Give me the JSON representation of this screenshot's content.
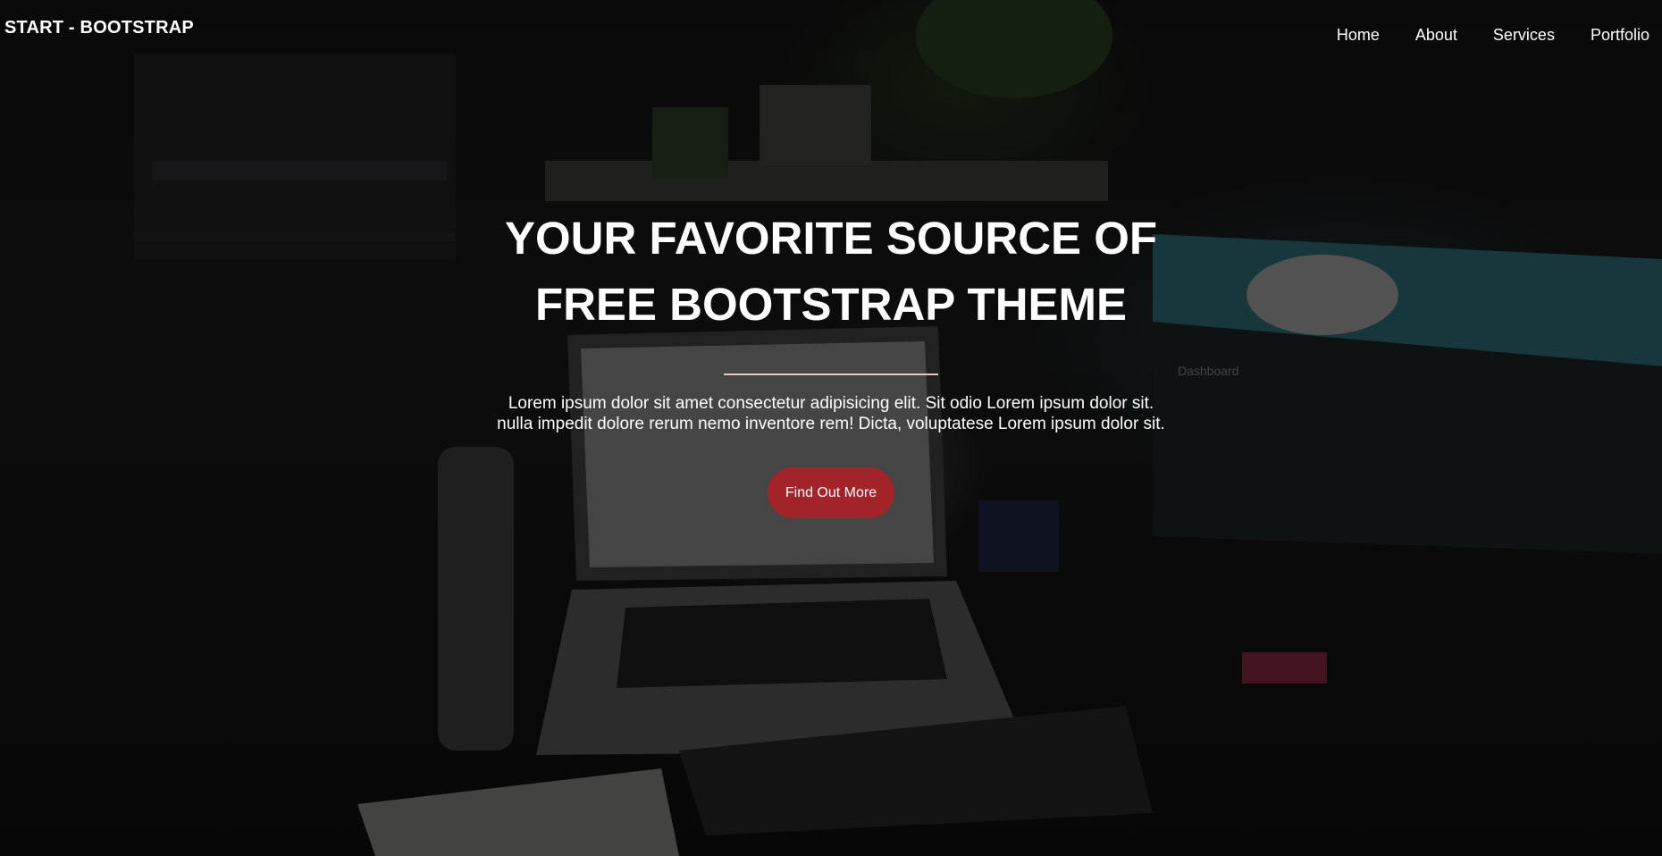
{
  "navbar": {
    "brand": "START - BOOTSTRAP",
    "links": [
      "Home",
      "About",
      "Services",
      "Portfolio"
    ]
  },
  "hero": {
    "headline_line1": "YOUR FAVORITE SOURCE OF",
    "headline_line2": "FREE BOOTSTRAP THEME",
    "lead_line1": "Lorem ipsum dolor sit amet consectetur adipisicing elit. Sit odio Lorem ipsum dolor sit.",
    "lead_line2": "nulla impedit dolore rerum nemo inventore rem! Dicta, voluptatese Lorem ipsum dolor sit.",
    "cta_label": "Find Out More",
    "background_image": "desk-workspace-photo"
  },
  "colors": {
    "cta_background": "#a2232a",
    "divider": "#e9c6bf",
    "text": "#ffffff"
  }
}
